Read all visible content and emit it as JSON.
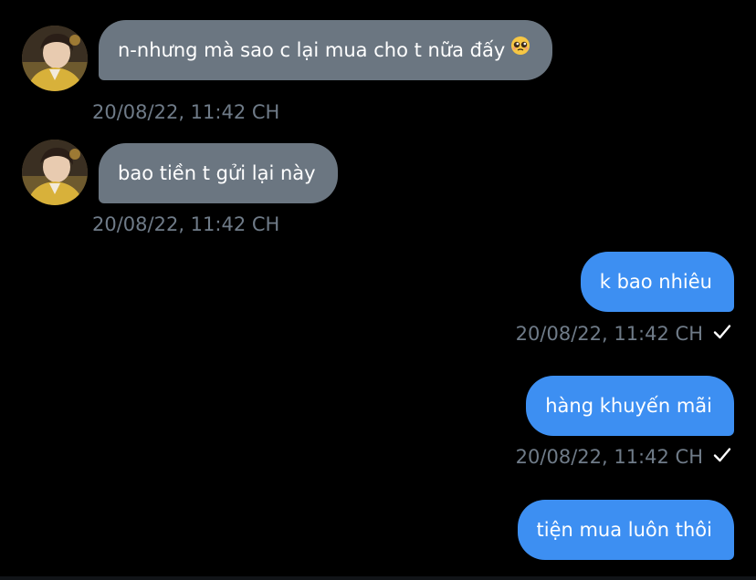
{
  "messages": [
    {
      "direction": "incoming",
      "text": "n-nhưng mà sao c lại mua cho t nữa đấy",
      "emoji": "pleading-face",
      "timestamp": "20/08/22, 11:42 CH"
    },
    {
      "direction": "incoming",
      "text": "bao tiền t gửi lại này",
      "timestamp": "20/08/22, 11:42 CH"
    },
    {
      "direction": "outgoing",
      "text": "k bao nhiêu",
      "timestamp": "20/08/22, 11:42 CH",
      "status_icon": "check-icon"
    },
    {
      "direction": "outgoing",
      "text": "hàng khuyến mãi",
      "timestamp": "20/08/22, 11:42 CH",
      "status_icon": "check-icon"
    },
    {
      "direction": "outgoing",
      "text": "tiện mua luôn thôi"
    }
  ],
  "colors": {
    "background": "#000000",
    "incoming_bubble": "#6b7681",
    "outgoing_bubble": "#3d8ff2",
    "timestamp_text": "#6f7b88",
    "bubble_text": "#ffffff"
  }
}
